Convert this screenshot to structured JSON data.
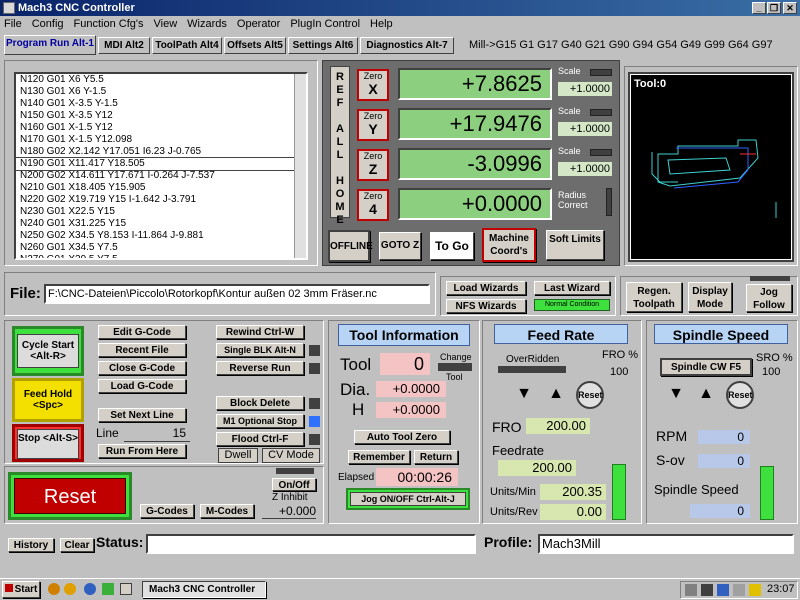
{
  "window": {
    "title": "Mach3 CNC Controller",
    "controls": [
      "_",
      "❐",
      "✕"
    ]
  },
  "menu": [
    "File",
    "Config",
    "Function Cfg's",
    "View",
    "Wizards",
    "Operator",
    "PlugIn Control",
    "Help"
  ],
  "tabs": [
    {
      "label": "Program Run Alt-1"
    },
    {
      "label": "MDI Alt2"
    },
    {
      "label": "ToolPath Alt4"
    },
    {
      "label": "Offsets Alt5"
    },
    {
      "label": "Settings Alt6"
    },
    {
      "label": "Diagnostics Alt-7"
    }
  ],
  "active_gcodes": "Mill->G15  G1 G17 G40 G21 G90 G94 G54 G49 G99 G64 G97",
  "gcode_lines": [
    "N120 G01 X6 Y5.5",
    "N130 G01 X6 Y-1.5",
    "N140 G01 X-3.5 Y-1.5",
    "N150 G01 X-3.5 Y12",
    "N160 G01 X-1.5 Y12",
    "N170 G01 X-1.5 Y12.098",
    "N180 G02 X2.142 Y17.051 I6.23 J-0.765",
    "N190 G01 X11.417 Y18.505",
    "N200 G02 X14.611 Y17.671 I-0.264 J-7.537",
    "N210 G01 X18.405 Y15.905",
    "N220 G02 X19.719 Y15 I-1.642 J-3.791",
    "N230 G01 X22.5 Y15",
    "N240 G01 X31.225 Y15",
    "N250 G02 X34.5 Y8.153 I-11.864 J-9.881",
    "N260 G01 X34.5 Y7.5",
    "N270 G01 X39.5 Y7.5"
  ],
  "dro": {
    "ref_all_home": "REF ALL HOME",
    "zero_label": "Zero",
    "axes": [
      {
        "name": "X",
        "value": "+7.8625",
        "scale": "+1.0000"
      },
      {
        "name": "Y",
        "value": "+17.9476",
        "scale": "+1.0000"
      },
      {
        "name": "Z",
        "value": "-3.0996",
        "scale": "+1.0000"
      },
      {
        "name": "4",
        "value": "+0.0000"
      }
    ],
    "scale_label": "Scale",
    "radius_correct": "Radius Correct"
  },
  "dro_buttons": {
    "offline": "OFFLINE",
    "goto_z": "GOTO Z",
    "to_go": "To Go",
    "machine_coords": "Machine Coord's",
    "soft_limits": "Soft Limits"
  },
  "toolpath": {
    "label": "Tool:0"
  },
  "file": {
    "label": "File:",
    "path": "F:\\CNC-Dateien\\Piccolo\\Rotorkopf\\Kontur außen 02 3mm Fräser.nc"
  },
  "wizards": {
    "load": "Load Wizards",
    "last": "Last Wizard",
    "nfs": "NFS Wizards",
    "normal_condition": "Normal Condition"
  },
  "view_buttons": {
    "regen": "Regen. Toolpath",
    "display_mode": "Display Mode",
    "jog_follow": "Jog Follow"
  },
  "program": {
    "cycle_start": "Cycle Start <Alt-R>",
    "feed_hold": "Feed Hold <Spc>",
    "stop": "Stop <Alt-S>",
    "reset": "Reset",
    "edit_gcode": "Edit G-Code",
    "recent_file": "Recent File",
    "close_gcode": "Close G-Code",
    "load_gcode": "Load G-Code",
    "set_next_line": "Set Next Line",
    "line_label": "Line",
    "line_value": "15",
    "run_from_here": "Run From Here",
    "rewind": "Rewind Ctrl-W",
    "single_blk": "Single BLK Alt-N",
    "reverse_run": "Reverse Run",
    "block_delete": "Block Delete",
    "m1_optional": "M1 Optional Stop",
    "flood": "Flood Ctrl-F",
    "dwell": "Dwell",
    "cv_mode": "CV Mode",
    "on_off": "On/Off",
    "z_inhibit": "Z Inhibit",
    "z_inhibit_value": "+0.000",
    "gcodes_btn": "G-Codes",
    "mcodes_btn": "M-Codes"
  },
  "tool_info": {
    "header": "Tool Information",
    "tool_label": "Tool",
    "tool_value": "0",
    "change_label": "Change",
    "tool_small": "Tool",
    "dia_label": "Dia.",
    "dia_value": "+0.0000",
    "h_label": "H",
    "h_value": "+0.0000",
    "auto_tool_zero": "Auto Tool Zero",
    "remember": "Remember",
    "return": "Return",
    "elapsed_label": "Elapsed",
    "elapsed_value": "00:00:26",
    "jog_onoff": "Jog ON/OFF Ctrl-Alt-J"
  },
  "feed_rate": {
    "header": "Feed Rate",
    "overridden": "OverRidden",
    "fro_pct_label": "FRO %",
    "fro_pct_value": "100",
    "reset": "Reset",
    "fro_label": "FRO",
    "fro_value": "200.00",
    "feedrate_label": "Feedrate",
    "feedrate_value": "200.00",
    "units_min_label": "Units/Min",
    "units_min_value": "200.35",
    "units_rev_label": "Units/Rev",
    "units_rev_value": "0.00"
  },
  "spindle": {
    "header": "Spindle Speed",
    "cw_button": "Spindle CW F5",
    "sro_label": "SRO %",
    "sro_value": "100",
    "reset": "Reset",
    "rpm_label": "RPM",
    "rpm_value": "0",
    "sov_label": "S-ov",
    "sov_value": "0",
    "speed_label": "Spindle Speed",
    "speed_value": "0"
  },
  "status": {
    "history": "History",
    "clear": "Clear",
    "status_label": "Status:",
    "status_value": "",
    "profile_label": "Profile:",
    "profile_value": "Mach3Mill"
  },
  "taskbar": {
    "start": "Start",
    "task": "Mach3 CNC Controller",
    "clock": "23:07"
  },
  "colors": {
    "dro_green": "#8ccf7e",
    "title_blue": "#0a246a",
    "reset_red": "#c00000",
    "accent_green": "#3de03d"
  }
}
